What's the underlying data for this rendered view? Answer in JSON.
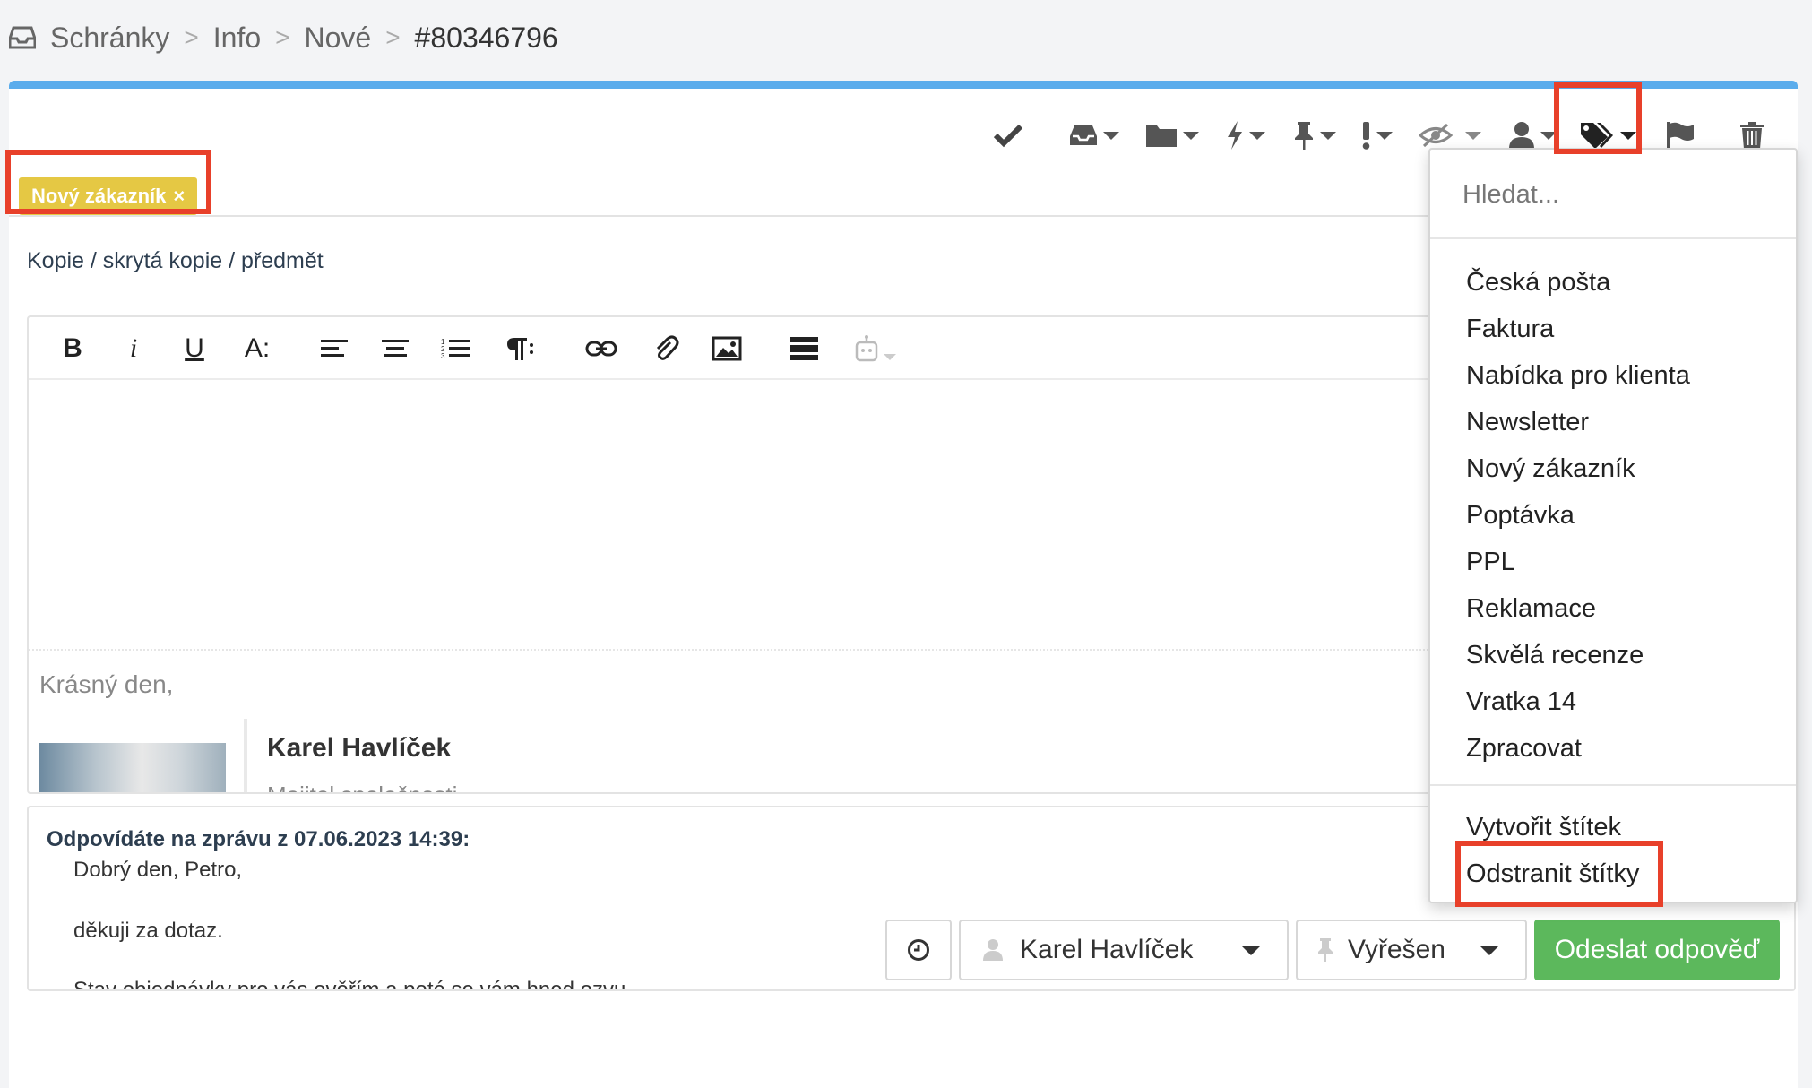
{
  "breadcrumb": {
    "items": [
      "Schránky",
      "Info",
      "Nové"
    ],
    "separator": ">",
    "current": "#80346796"
  },
  "toolbar": {
    "icons": [
      "check-icon",
      "inbox-icon",
      "folder-icon",
      "bolt-icon",
      "pin-icon",
      "exclamation-icon",
      "eye-slash-icon",
      "user-icon",
      "tags-icon",
      "flag-icon",
      "trash-icon"
    ]
  },
  "tags": {
    "chip_label": "Nový zákazník",
    "chip_remove": "×",
    "chip_color": "#e5c844"
  },
  "compose": {
    "cc_link": "Kopie / skrytá kopie / předmět",
    "toolbar": {
      "bold": "B",
      "italic": "i",
      "underline": "U",
      "font_size": "A:"
    },
    "greeting": "Krásný den,",
    "signature_name": "Karel Havlíček",
    "signature_role": "Majitel společnosti"
  },
  "quote": {
    "title": "Odpovídáte na zprávu z 07.06.2023 14:39:",
    "lines": [
      "Dobrý den, Petro,",
      "děkuji za dotaz.",
      "Stav objednávky pro vás ověřím a poté se vám hned ozvu."
    ]
  },
  "bottom": {
    "assignee": "Karel Havlíček",
    "status": "Vyřešen",
    "send": "Odeslat odpověď",
    "send_color": "#5cb85c"
  },
  "dropdown": {
    "search_placeholder": "Hledat...",
    "items": [
      "Česká pošta",
      "Faktura",
      "Nabídka pro klienta",
      "Newsletter",
      "Nový zákazník",
      "Poptávka",
      "PPL",
      "Reklamace",
      "Skvělá recenze",
      "Vratka 14",
      "Zpracovat"
    ],
    "create": "Vytvořit štítek",
    "remove": "Odstranit štítky"
  },
  "colors": {
    "accent": "#5aacec",
    "highlight": "#e8402a"
  }
}
